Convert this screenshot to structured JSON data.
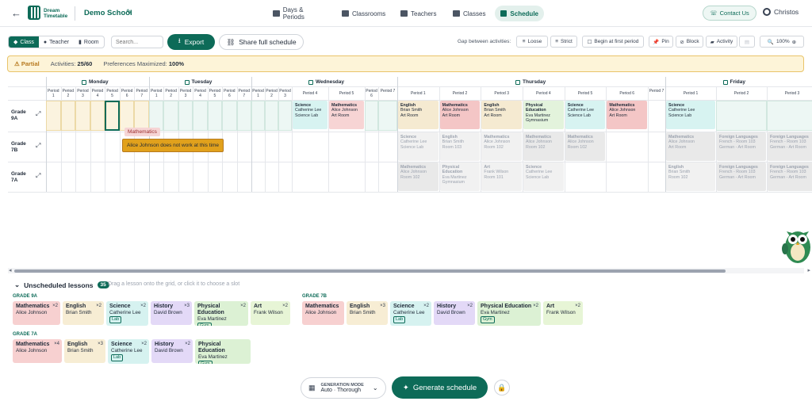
{
  "header": {
    "logo_line1": "Dream",
    "logo_line2": "Timetable",
    "school": "Demo School",
    "nav": [
      {
        "label": "Days & Periods",
        "icon": "calendar-icon"
      },
      {
        "label": "Classrooms",
        "icon": "building-icon"
      },
      {
        "label": "Teachers",
        "icon": "graduation-cap-icon"
      },
      {
        "label": "Classes",
        "icon": "users-icon"
      },
      {
        "label": "Schedule",
        "icon": "calendar-icon",
        "active": true
      }
    ],
    "contact": "Contact Us",
    "user": "Christos"
  },
  "toolbar": {
    "view": [
      "Class",
      "Teacher",
      "Room"
    ],
    "search_placeholder": "Search...",
    "export": "Export",
    "share": "Share full schedule",
    "gap_label": "Gap between activities:",
    "loose": "Loose",
    "strict": "Strict",
    "begin": "Begin at first period",
    "pin": "Pin",
    "block": "Block",
    "activity": "Activity",
    "zoom": "100%"
  },
  "status": {
    "badge": "Partial",
    "activities_label": "Activities:",
    "activities": "25/60",
    "pref_label": "Preferences Maximized:",
    "pref": "100%"
  },
  "days": [
    {
      "name": "Monday",
      "periods": [
        "Period 1",
        "Period 2",
        "Period 3",
        "Period 4",
        "Period 5",
        "Period 6",
        "Period 7"
      ]
    },
    {
      "name": "Tuesday",
      "periods": [
        "Period 1",
        "Period 2",
        "Period 3",
        "Period 4",
        "Period 5",
        "Period 6",
        "Period 7"
      ]
    },
    {
      "name": "Wednesday",
      "periods": [
        "Period 1",
        "Period 2",
        "Period 3",
        "Period 4",
        "Period 5",
        "Period 6",
        "Period 7"
      ]
    },
    {
      "name": "Thursday",
      "periods": [
        "Period 1",
        "Period 2",
        "Period 3",
        "Period 4",
        "Period 5",
        "Period 6",
        "Period 7"
      ]
    },
    {
      "name": "Friday",
      "periods": [
        "Period 1",
        "Period 2",
        "Period 3"
      ]
    }
  ],
  "rows": [
    {
      "line1": "Grade",
      "line2": "9A"
    },
    {
      "line1": "Grade",
      "line2": "7B"
    },
    {
      "line1": "Grade",
      "line2": "7A"
    }
  ],
  "lessons": [
    {
      "row": 0,
      "slot": "wed4",
      "subject": "Science",
      "teacher": "Catherine Lee",
      "room": "Science Lab",
      "color": "#d7f3f1"
    },
    {
      "row": 0,
      "slot": "wed5",
      "subject": "Mathematics",
      "teacher": "Alice Johnson",
      "room": "Art Room",
      "color": "#f7d4d4"
    },
    {
      "row": 0,
      "slot": "thu1",
      "subject": "English",
      "teacher": "Brian Smith",
      "room": "Art Room",
      "color": "#f5ead1"
    },
    {
      "row": 0,
      "slot": "thu2",
      "subject": "Mathematics",
      "teacher": "Alice Johnson",
      "room": "Art Room",
      "color": "#f4c6c6"
    },
    {
      "row": 0,
      "slot": "thu3",
      "subject": "English",
      "teacher": "Brian Smith",
      "room": "Art Room",
      "color": "#f5ead1"
    },
    {
      "row": 0,
      "slot": "thu4",
      "subject": "Physical Education",
      "teacher": "Eva Martinez",
      "room": "Gymnasium",
      "color": "#e3f3dc"
    },
    {
      "row": 0,
      "slot": "thu5",
      "subject": "Science",
      "teacher": "Catherine Lee",
      "room": "Science Lab",
      "color": "#d7f3f1"
    },
    {
      "row": 0,
      "slot": "thu6",
      "subject": "Mathematics",
      "teacher": "Alice Johnson",
      "room": "Art Room",
      "color": "#f4c6c6"
    },
    {
      "row": 0,
      "slot": "fri1",
      "subject": "Science",
      "teacher": "Catherine Lee",
      "room": "Science Lab",
      "color": "#d7f3f1"
    },
    {
      "row": 1,
      "slot": "thu1",
      "subject": "Science",
      "teacher": "Catherine Lee",
      "room": "Science Lab",
      "color": "#f1f1f1"
    },
    {
      "row": 1,
      "slot": "thu2",
      "subject": "English",
      "teacher": "Brian Smith",
      "room": "Room 103",
      "color": "#f1f1f1"
    },
    {
      "row": 1,
      "slot": "thu3",
      "subject": "Mathematics",
      "teacher": "Alice Johnson",
      "room": "Room 102",
      "color": "#f1f1f1"
    },
    {
      "row": 1,
      "slot": "thu4",
      "subject": "Mathematics",
      "teacher": "Alice Johnson",
      "room": "Room 102",
      "color": "#e9e9e9"
    },
    {
      "row": 1,
      "slot": "thu5",
      "subject": "Mathematics",
      "teacher": "Alice Johnson",
      "room": "Room 102",
      "color": "#e9e9e9"
    },
    {
      "row": 1,
      "slot": "fri1",
      "subject": "Mathematics",
      "teacher": "Alice Johnson",
      "room": "Art Room",
      "color": "#e9e9e9"
    },
    {
      "row": 1,
      "slot": "fri2",
      "subject": "Foreign Languages",
      "teacher": "French - Room 103",
      "room": "German - Art Room",
      "color": "#e9e9e9"
    },
    {
      "row": 1,
      "slot": "fri3",
      "subject": "Foreign Languages",
      "teacher": "French - Room 103",
      "room": "German - Art Room",
      "color": "#e9e9e9"
    },
    {
      "row": 2,
      "slot": "thu1",
      "subject": "Mathematics",
      "teacher": "Alice Johnson",
      "room": "Room 102",
      "color": "#e9e9e9"
    },
    {
      "row": 2,
      "slot": "thu2",
      "subject": "Physical Education",
      "teacher": "Eva Martinez",
      "room": "Gymnasium",
      "color": "#f1f1f1"
    },
    {
      "row": 2,
      "slot": "thu3",
      "subject": "Art",
      "teacher": "Frank Wilson",
      "room": "Room 101",
      "color": "#f1f1f1"
    },
    {
      "row": 2,
      "slot": "thu4",
      "subject": "Science",
      "teacher": "Catherine Lee",
      "room": "Science Lab",
      "color": "#f1f1f1"
    },
    {
      "row": 2,
      "slot": "fri1",
      "subject": "English",
      "teacher": "Brian Smith",
      "room": "Room 102",
      "color": "#f1f1f1"
    },
    {
      "row": 2,
      "slot": "fri2",
      "subject": "Foreign Languages",
      "teacher": "French - Room 103",
      "room": "German - Art Room",
      "color": "#e9e9e9"
    },
    {
      "row": 2,
      "slot": "fri3",
      "subject": "Foreign Languages",
      "teacher": "French - Room 103",
      "room": "German - Art Room",
      "color": "#e9e9e9"
    }
  ],
  "drag": {
    "label": "Mathematics",
    "tooltip": "Alice Johnson does not work at this time"
  },
  "unscheduled": {
    "title": "Unscheduled lessons",
    "count": "35",
    "hint": "Drag a lesson onto the grid, or click it to choose a slot",
    "groups": [
      {
        "name": "GRADE 9A",
        "cards": [
          {
            "subject": "Mathematics",
            "teacher": "Alice Johnson",
            "mult": "×2",
            "color": "#f7d0d0"
          },
          {
            "subject": "English",
            "teacher": "Brian Smith",
            "mult": "×2",
            "color": "#f7edd4"
          },
          {
            "subject": "Science",
            "teacher": "Catherine Lee",
            "mult": "×2",
            "tag": "Lab",
            "color": "#d6f2f0"
          },
          {
            "subject": "History",
            "teacher": "David Brown",
            "mult": "×3",
            "color": "#e3d9f7"
          },
          {
            "subject": "Physical Education",
            "teacher": "Eva Martinez",
            "mult": "×2",
            "tag": "Gym",
            "color": "#dcf1d4"
          },
          {
            "subject": "Art",
            "teacher": "Frank Wilson",
            "mult": "×2",
            "color": "#e7f5d6"
          }
        ]
      },
      {
        "name": "GRADE 7B",
        "cards": [
          {
            "subject": "Mathematics",
            "teacher": "Alice Johnson",
            "mult": "",
            "color": "#f7d0d0"
          },
          {
            "subject": "English",
            "teacher": "Brian Smith",
            "mult": "×3",
            "color": "#f7edd4"
          },
          {
            "subject": "Science",
            "teacher": "Catherine Lee",
            "mult": "×2",
            "tag": "Lab",
            "color": "#d6f2f0"
          },
          {
            "subject": "History",
            "teacher": "David Brown",
            "mult": "×2",
            "color": "#e3d9f7"
          },
          {
            "subject": "Physical Education",
            "teacher": "Eva Martinez",
            "mult": "×2",
            "tag": "Gym",
            "color": "#dcf1d4"
          },
          {
            "subject": "Art",
            "teacher": "Frank Wilson",
            "mult": "×2",
            "color": "#e7f5d6"
          }
        ]
      },
      {
        "name": "GRADE 7A",
        "cards": [
          {
            "subject": "Mathematics",
            "teacher": "Alice Johnson",
            "mult": "×4",
            "color": "#f7d0d0"
          },
          {
            "subject": "English",
            "teacher": "Brian Smith",
            "mult": "×3",
            "color": "#f7edd4"
          },
          {
            "subject": "Science",
            "teacher": "Catherine Lee",
            "mult": "×2",
            "tag": "Lab",
            "color": "#d6f2f0"
          },
          {
            "subject": "History",
            "teacher": "David Brown",
            "mult": "×2",
            "color": "#e3d9f7"
          },
          {
            "subject": "Physical Education",
            "teacher": "Eva Martinez",
            "mult": "",
            "tag": "Gym",
            "color": "#dcf1d4"
          }
        ]
      }
    ]
  },
  "generate": {
    "mode_label": "GENERATION MODE",
    "mode": "Auto · Thorough",
    "button": "Generate schedule"
  },
  "colors": {
    "accent": "#0d6b58",
    "warning": "#e9c46a"
  }
}
